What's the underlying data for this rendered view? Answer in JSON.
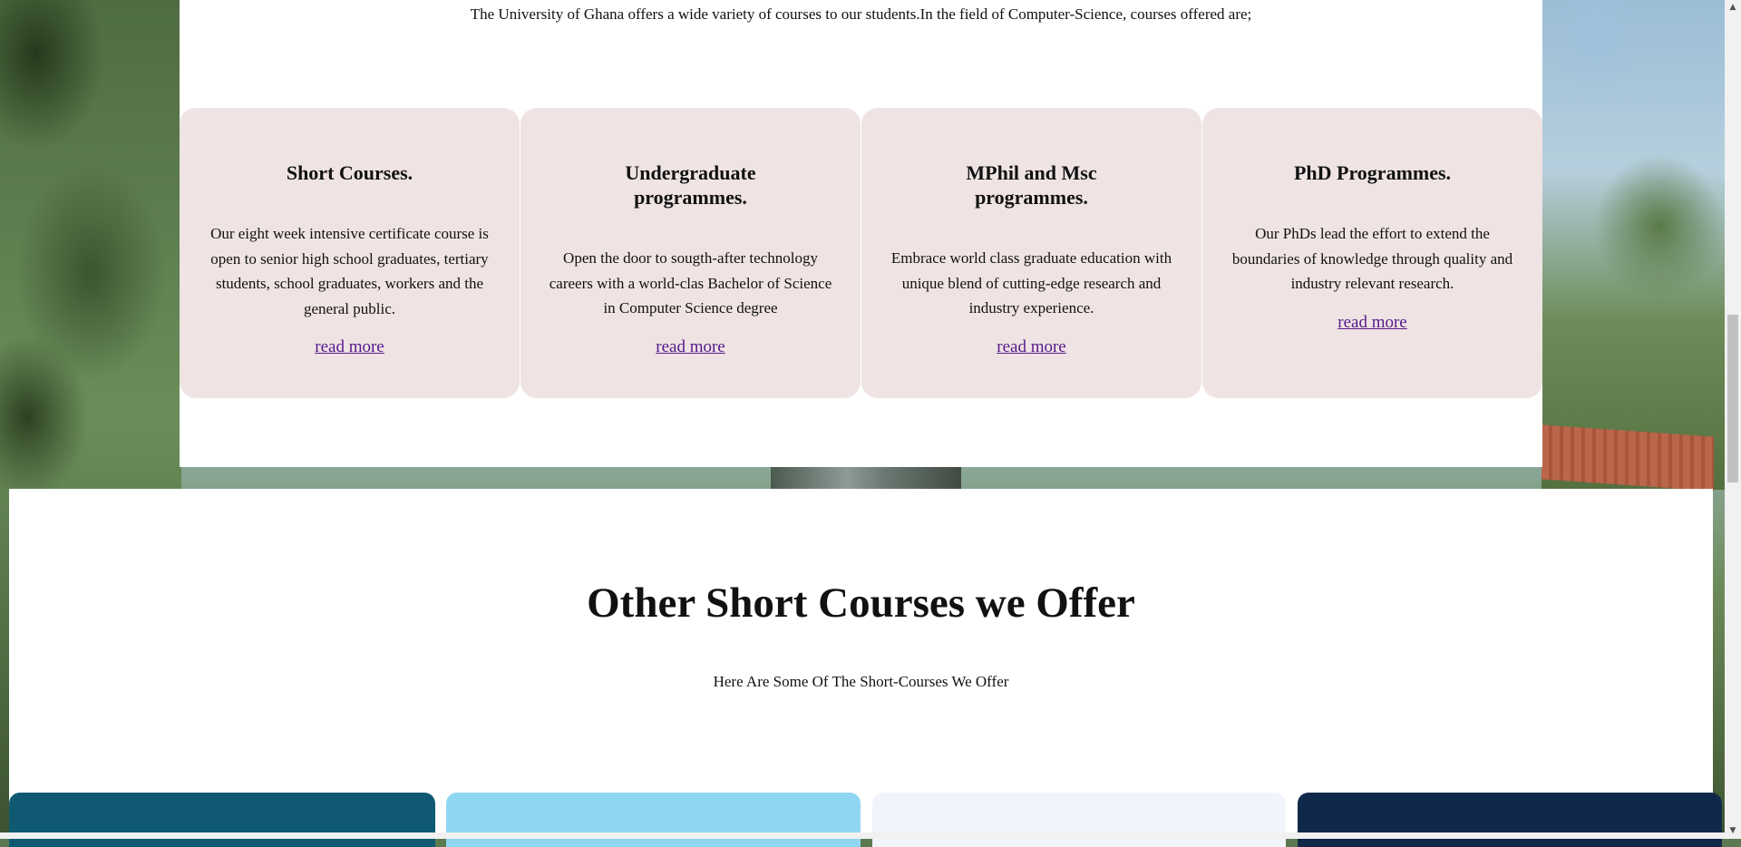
{
  "intro": "The University of Ghana offers a wide variety of courses to our students.In the field of Computer-Science, courses offered are;",
  "cards": [
    {
      "title": "Short Courses.",
      "body": "Our eight week intensive certificate course is open to senior high school graduates, tertiary students, school graduates, workers and the general public.",
      "link": "read more"
    },
    {
      "title": "Undergraduate programmes.",
      "body": "Open the door to sougth-after technology careers with a world-clas Bachelor of Science in Computer Science degree",
      "link": "read more"
    },
    {
      "title": "MPhil and Msc programmes.",
      "body": "Embrace world class graduate education with unique blend of cutting-edge research and industry experience.",
      "link": "read more"
    },
    {
      "title": "PhD Programmes.",
      "body": "Our PhDs lead the effort to extend the boundaries of knowledge through quality and industry relevant research.",
      "link": "read more"
    }
  ],
  "short_courses": {
    "title": "Other Short Courses we Offer",
    "subtitle": "Here Are Some Of The Short-Courses We Offer"
  },
  "colors": {
    "card_bg": "#efe3e3",
    "link": "#551a8b"
  },
  "icons": {
    "scroll_up": "▲",
    "scroll_down": "▼"
  }
}
